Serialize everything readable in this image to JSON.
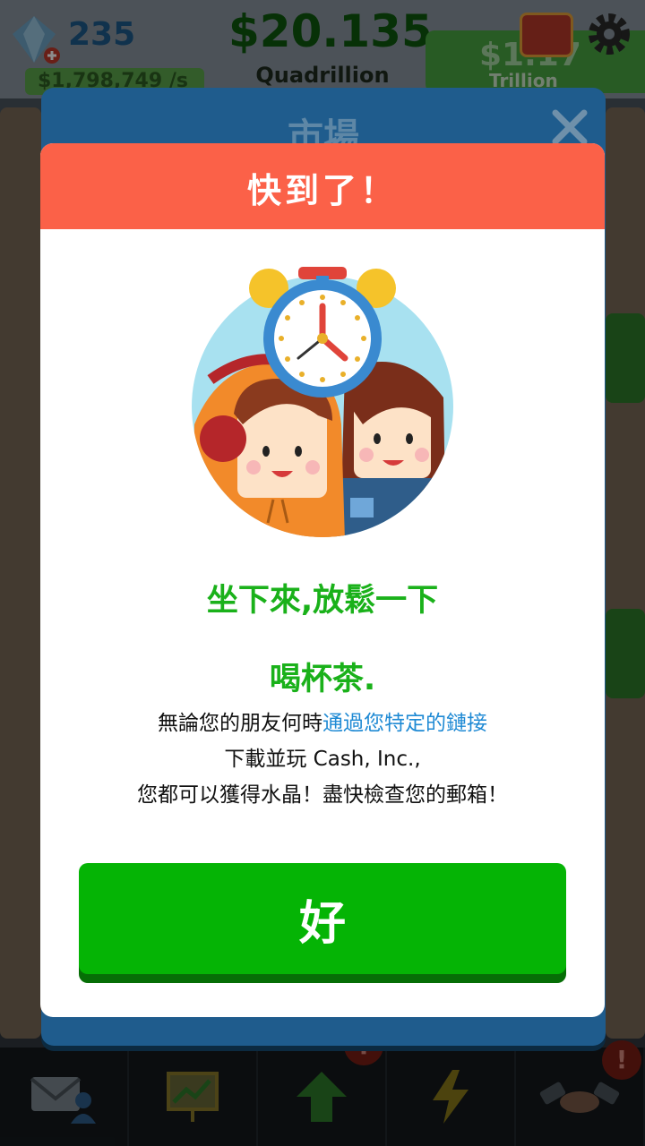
{
  "hud": {
    "gems": "235",
    "income_rate": "$1,798,749 /s",
    "cash": "$20.135",
    "cash_unit": "Quadrillion",
    "secondary_value": "$1.17",
    "secondary_unit": "Trillion"
  },
  "market": {
    "title": "市場"
  },
  "alert": {
    "title": "快到了！",
    "headline": "坐下來,放鬆一下",
    "subhead": "喝杯茶.",
    "body_line1_prefix": "無論您的朋友何時",
    "body_line1_link": "通過您特定的鏈接",
    "body_line2": "下載並玩 Cash, Inc.,",
    "body_line3": "您都可以獲得水晶！盡快檢查您的郵箱！",
    "ok_label": "好"
  },
  "bottom_nav": {
    "items": [
      "mail",
      "stats",
      "upgrade",
      "boost",
      "deals"
    ],
    "alerts": [
      "!",
      "!"
    ]
  },
  "colors": {
    "header": "#fb6148",
    "headline_green": "#1ab11a",
    "button_green": "#05b405",
    "link_blue": "#1f8ad4",
    "market_blue": "#1f5c8d"
  }
}
